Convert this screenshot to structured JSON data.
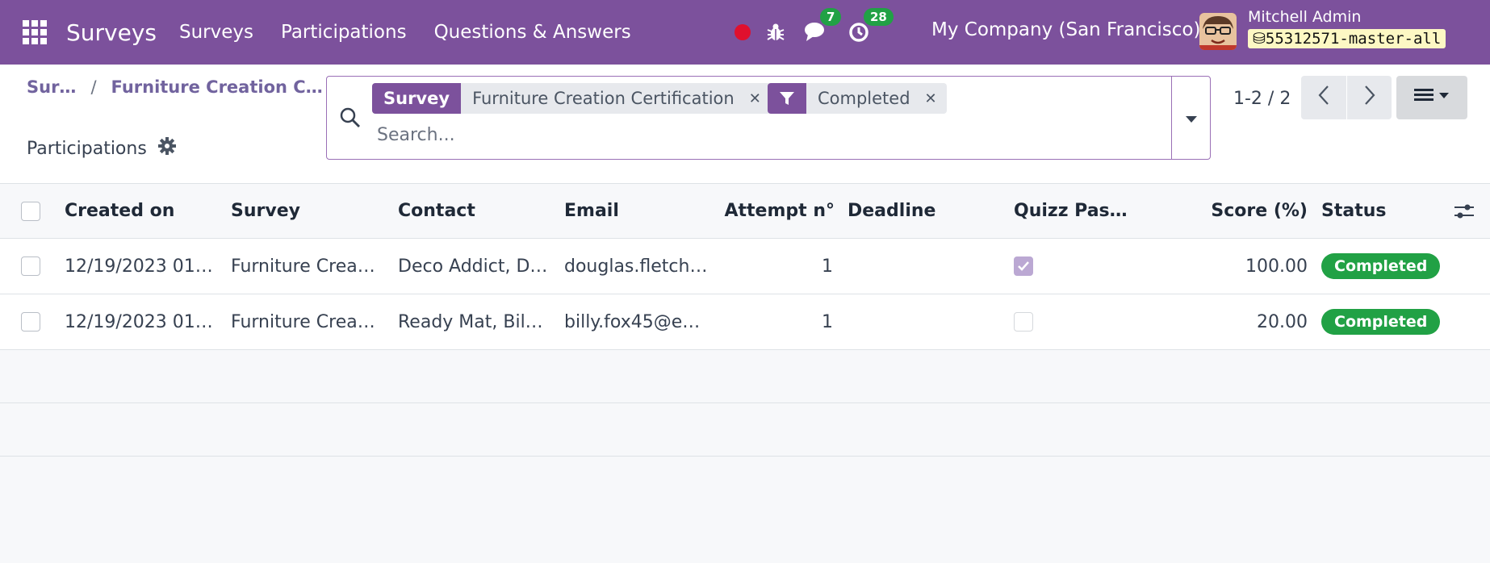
{
  "navbar": {
    "brand": "Surveys",
    "menu": [
      "Surveys",
      "Participations",
      "Questions & Answers"
    ],
    "chat_count": "7",
    "activity_count": "28",
    "company": "My Company (San Francisco)",
    "user": "Mitchell Admin",
    "db": "55312571-master-all"
  },
  "breadcrumb": {
    "root": "Sur…",
    "current": "Furniture Creation C…"
  },
  "page": {
    "subtitle": "Participations"
  },
  "search": {
    "facets": [
      {
        "label": "Survey",
        "value": "Furniture Creation Certification",
        "icon": ""
      },
      {
        "label": "",
        "value": "Completed",
        "icon": "filter-icon"
      }
    ],
    "placeholder": "Search..."
  },
  "pager": {
    "value": "1-2 / 2"
  },
  "table": {
    "columns": [
      "Created on",
      "Survey",
      "Contact",
      "Email",
      "Attempt n°",
      "Deadline",
      "Quizz Pas…",
      "Score (%)",
      "Status"
    ],
    "rows": [
      {
        "created": "12/19/2023 01…",
        "survey": "Furniture Crea…",
        "contact": "Deco Addict, D…",
        "email": "douglas.fletch…",
        "attempt": "1",
        "deadline": "",
        "passed": true,
        "score": "100.00",
        "status": "Completed"
      },
      {
        "created": "12/19/2023 01…",
        "survey": "Furniture Crea…",
        "contact": "Ready Mat, Bil…",
        "email": "billy.fox45@e…",
        "attempt": "1",
        "deadline": "",
        "passed": false,
        "score": "20.00",
        "status": "Completed"
      }
    ]
  },
  "colors": {
    "brand": "#7c519c",
    "success": "#21a145"
  }
}
